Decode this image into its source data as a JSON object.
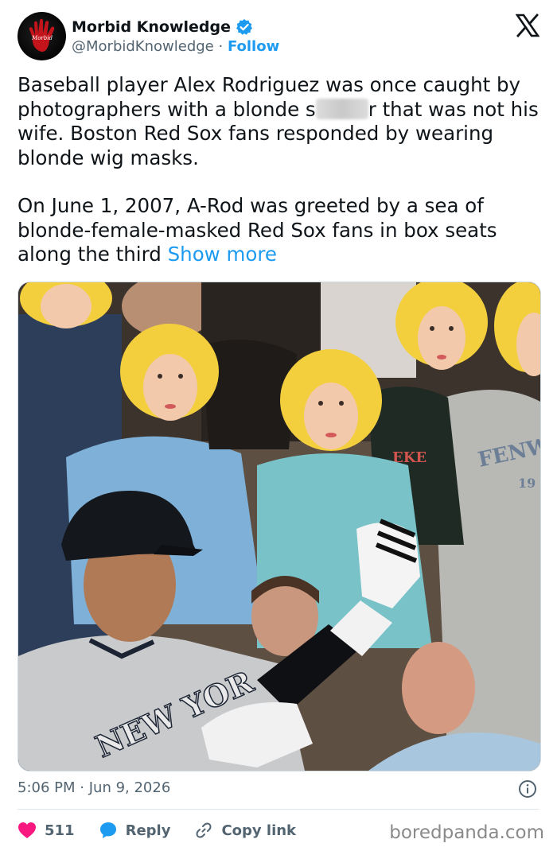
{
  "author": {
    "display_name": "Morbid Knowledge",
    "handle": "@MorbidKnowledge",
    "separator": "·",
    "follow_label": "Follow",
    "avatar_icon": "red-handprint-logo-icon",
    "verified_icon": "verified-badge-icon",
    "verified_color": "#1d9bf0"
  },
  "platform_icon": "x-logo-icon",
  "tweet": {
    "line_segment_1": "Baseball player Alex Rodriguez was once caught by photographers with a blonde s",
    "line_segment_2": "r that was not his wife. Boston Red Sox fans responded by wearing blonde wig masks.",
    "paragraph_2": "On June 1, 2007, A-Rod was greeted by a sea of blonde-female-masked Red Sox fans in box seats along the third ",
    "show_more_label": "Show more"
  },
  "photo": {
    "jersey_text_front": "NEW YOR",
    "jersey_text_bg1": "FENW",
    "jersey_text_bg2": "19",
    "jersey_text_bg3": "EKE"
  },
  "meta": {
    "time": "5:06 PM",
    "separator": "·",
    "date": "Jun 9, 2026",
    "info_icon": "info-circle-icon"
  },
  "actions": {
    "like_count": "511",
    "reply_label": "Reply",
    "copy_link_label": "Copy link",
    "like_icon": "heart-icon",
    "reply_icon": "speech-bubble-icon",
    "copy_icon": "link-icon",
    "like_color": "#f91880",
    "reply_color": "#1d9bf0"
  },
  "watermark": "boredpanda.com"
}
